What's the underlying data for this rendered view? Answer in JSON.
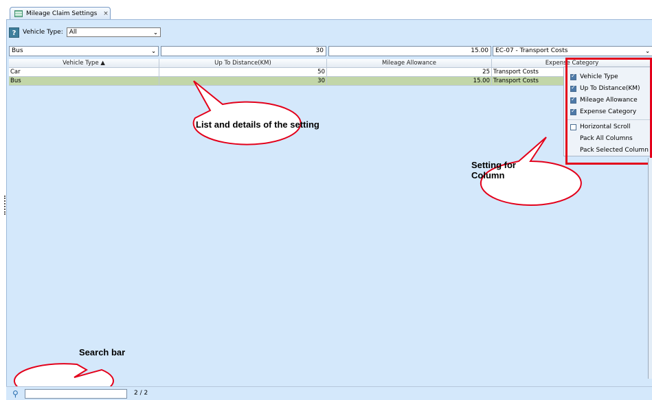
{
  "tab": {
    "label": "Mileage Claim Settings",
    "close": "×"
  },
  "toolbar": {
    "help": "?",
    "vehicle_type_label": "Vehicle Type:",
    "vehicle_type_value": "All"
  },
  "filter": {
    "vehicle": "Bus",
    "distance": "30",
    "allowance": "15.00",
    "category": "EC-07 - Transport Costs"
  },
  "table": {
    "columns": [
      "Vehicle Type ▲",
      "Up To Distance(KM)",
      "Mileage Allowance",
      "Expense Category"
    ],
    "rows": [
      {
        "vehicle": "Car",
        "distance": "50",
        "allowance": "25",
        "category": "Transport Costs"
      },
      {
        "vehicle": "Bus",
        "distance": "30",
        "allowance": "15.00",
        "category": "Transport Costs"
      }
    ]
  },
  "column_menu": {
    "items": [
      "Vehicle Type",
      "Up To Distance(KM)",
      "Mileage Allowance",
      "Expense Category"
    ],
    "horizontal_scroll": "Horizontal Scroll",
    "pack_all": "Pack All Columns",
    "pack_selected": "Pack Selected Column"
  },
  "callouts": {
    "list": "List and details of the setting",
    "column": "Setting for Column",
    "search": "Search bar"
  },
  "status": {
    "page_count": "2 / 2"
  },
  "colors": {
    "accent_red": "#e3001a",
    "panel_bg": "#d4e8fb",
    "selected_row": "#c2d6a8"
  },
  "icons": [
    "table-icon",
    "help-icon",
    "chevron-down-icon",
    "search-icon",
    "checkbox-icon"
  ]
}
